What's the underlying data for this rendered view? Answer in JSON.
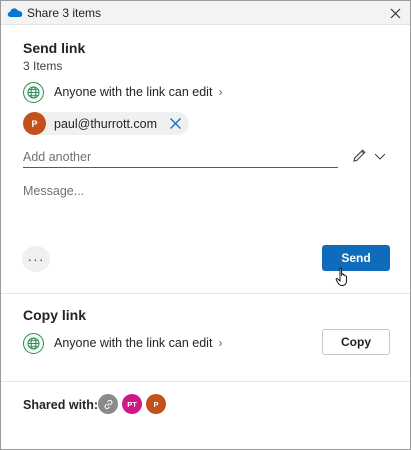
{
  "window": {
    "title": "Share 3 items"
  },
  "send_section": {
    "title": "Send link",
    "items_count": "3 Items",
    "permission": "Anyone with the link can edit",
    "recipient": {
      "initial": "P",
      "email": "paul@thurrott.com"
    },
    "add_placeholder": "Add another",
    "message_placeholder": "Message...",
    "more_label": "···",
    "send_label": "Send"
  },
  "copy_section": {
    "title": "Copy link",
    "permission": "Anyone with the link can edit",
    "copy_label": "Copy"
  },
  "shared_with": {
    "label": "Shared with:",
    "avatars": [
      {
        "initials": "",
        "icon": "link-icon",
        "color": "#8a8a8a"
      },
      {
        "initials": "PT",
        "color": "#d1158a"
      },
      {
        "initials": "P",
        "color": "#c4501c"
      }
    ]
  },
  "colors": {
    "accent": "#0f6cbd",
    "globe": "#2e8b57",
    "onedrive": "#0078d4"
  }
}
